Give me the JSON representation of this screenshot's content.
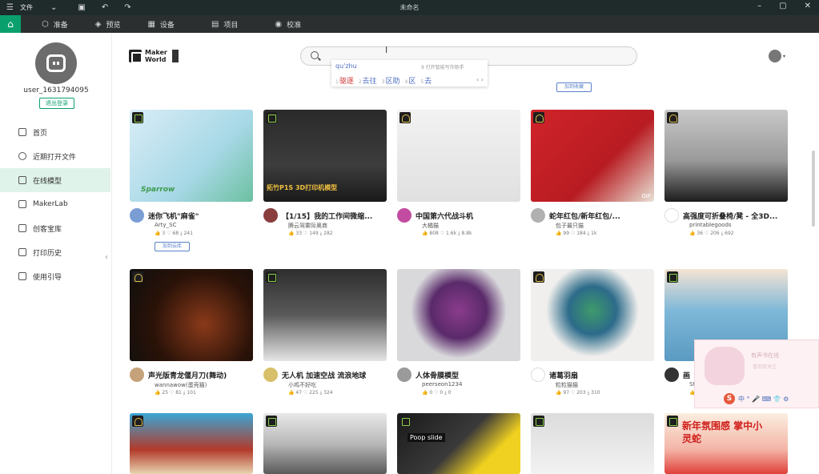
{
  "titlebar": {
    "menu_label": "文件",
    "title": "未命名"
  },
  "menubar": {
    "items": [
      "准备",
      "预览",
      "设备",
      "项目",
      "校准"
    ]
  },
  "sidebar": {
    "username": "user_1631794095",
    "logout_label": "退出登录",
    "items": [
      {
        "label": "首页",
        "icon": "home-icon"
      },
      {
        "label": "近期打开文件",
        "icon": "recent-files-icon"
      },
      {
        "label": "在线模型",
        "icon": "online-models-icon"
      },
      {
        "label": "MakerLab",
        "icon": "makerlab-icon"
      },
      {
        "label": "创客宝库",
        "icon": "maker-treasury-icon"
      },
      {
        "label": "打印历史",
        "icon": "print-history-icon"
      },
      {
        "label": "使用引导",
        "icon": "guide-icon"
      }
    ],
    "active_index": 2
  },
  "header": {
    "logo_line1": "Maker",
    "logo_line2": "World",
    "ime": {
      "pinyin": "qu'zhu",
      "hint": "9 打开智能写作助手",
      "candidates": [
        {
          "n": "1",
          "text": "驱逐"
        },
        {
          "n": "2",
          "text": "去往"
        },
        {
          "n": "3",
          "text": "区助"
        },
        {
          "n": "4",
          "text": "区"
        },
        {
          "n": "5",
          "text": "去"
        }
      ],
      "nav": "‹ ›"
    },
    "collect_label": "加到收藏"
  },
  "cards": [
    {
      "title": "迷你飞机\"麻雀\"",
      "author": "Arty_SC",
      "stats": "👍 3   ♡ 68   ⤓ 241",
      "collect": "加到云库",
      "badge": "maker",
      "thumb_text": "Sparrow"
    },
    {
      "title": "【1/15】我的工作间微缩...",
      "author": "腾云驾雾际奥商",
      "stats": "👍 33   ♡ 149   ⤓ 282",
      "badge": "maker",
      "thumb_text": "拓竹P1S 3D打印机模型"
    },
    {
      "title": "中国第六代战斗机",
      "author": "大橘猫",
      "stats": "👍 808   ♡ 1.6k   ⤓ 8.8k",
      "badge": "cup"
    },
    {
      "title": "蛇年红包/新年红包/...",
      "author": "包子最只猫",
      "stats": "👍 99   ♡ 184   ⤓ 1k",
      "badge": "cup",
      "thumb_text": "GIF"
    },
    {
      "title": "高强度可折叠椅/凳 - 全3D...",
      "author": "printablegoods",
      "stats": "👍 36   ♡ 206   ⤓ 692",
      "badge": "cup"
    },
    {
      "title": "声光版青龙偃月刀(舞动)",
      "author": "wannawow(蛋壳猫)",
      "stats": "👍 25   ♡ 81   ⤓ 101",
      "badge": "cup"
    },
    {
      "title": "无人机 加速空战 流浪地球",
      "author": "小鸡不好吃",
      "stats": "👍 47   ♡ 225   ⤓ 324",
      "badge": "maker"
    },
    {
      "title": "人体骨膜模型",
      "author": "peerseon1234",
      "stats": "👍 0   ♡ 0   ⤓ 0",
      "badge": "none"
    },
    {
      "title": "诸葛羽扇",
      "author": "粒粒猫猫",
      "stats": "👍 97   ♡ 203   ⤓ 310",
      "badge": "cup"
    },
    {
      "title": "画",
      "author": "St",
      "stats": "👍 0",
      "badge": "maker"
    },
    {
      "title": "",
      "author": "",
      "stats": "",
      "badge": "cup"
    },
    {
      "title": "",
      "author": "",
      "stats": "",
      "badge": "maker"
    },
    {
      "title": "",
      "author": "",
      "stats": "",
      "badge": "maker",
      "thumb_text": "Poop slide"
    },
    {
      "title": "",
      "author": "",
      "stats": "",
      "badge": "maker"
    },
    {
      "title": "",
      "author": "",
      "stats": "",
      "badge": "maker",
      "thumb_text": "新年氛围感 掌中小灵蛇"
    }
  ],
  "widget": {
    "title": "有声书在线",
    "subtitle": "喜欢就关注",
    "toolbar": "中 ° 🎤 ⌨ 👕 ⚙"
  }
}
